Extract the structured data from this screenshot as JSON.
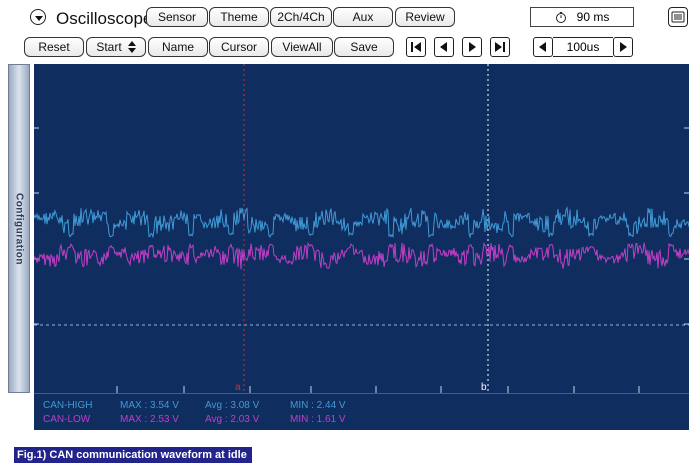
{
  "app": {
    "title": "Oscilloscope"
  },
  "toolbar_top": {
    "sensor": "Sensor",
    "theme": "Theme",
    "channels": "2Ch/4Ch",
    "aux": "Aux",
    "review": "Review",
    "time_per_screen": "90 ms"
  },
  "toolbar_bottom": {
    "reset": "Reset",
    "start": "Start",
    "name": "Name",
    "cursor": "Cursor",
    "viewall": "ViewAll",
    "save": "Save",
    "timebase": "100us"
  },
  "sidebar": {
    "label": "Configuration"
  },
  "cursors": {
    "a": "a",
    "b": "b"
  },
  "channels": [
    {
      "name": "CAN-HIGH",
      "max": "MAX : 3.54 V",
      "avg": "Avg : 3.08 V",
      "min": "MIN : 2.44 V",
      "color": "#3f9ad6"
    },
    {
      "name": "CAN-LOW",
      "max": "MAX : 2.53 V",
      "avg": "Avg : 2.03 V",
      "min": "MIN : 1.61 V",
      "color": "#c13fc7"
    }
  ],
  "caption": "Fig.1) CAN communication waveform at idle",
  "colors": {
    "screen_bg": "#0f2d5e",
    "caption_bg": "#22238b"
  }
}
